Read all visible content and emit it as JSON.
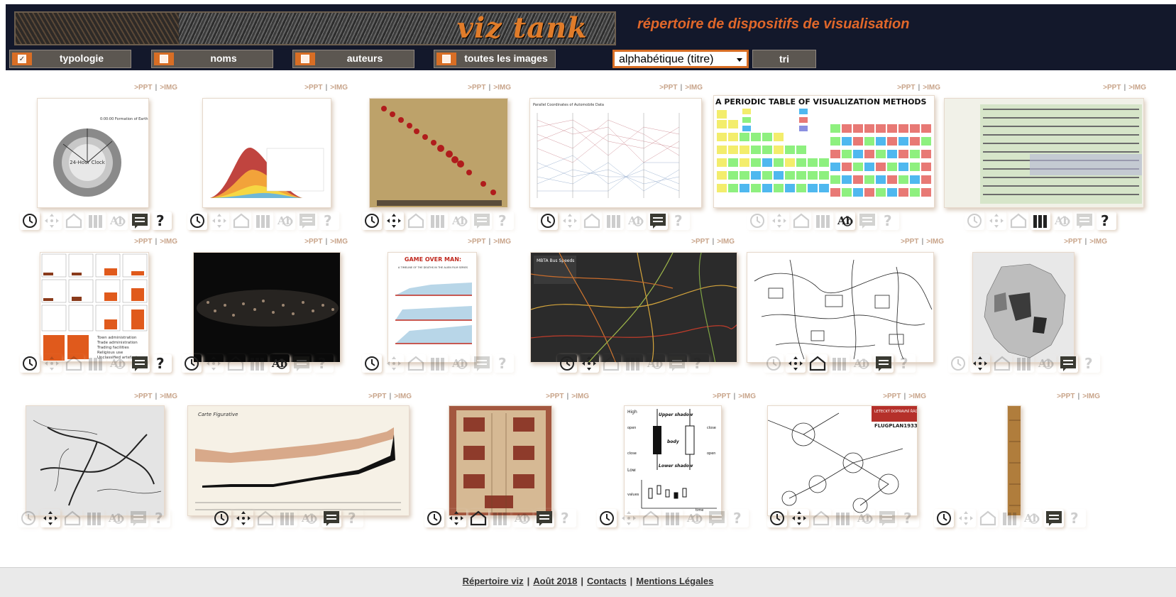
{
  "header": {
    "logo_text": "viz tank",
    "subtitle": "répertoire de dispositifs de visualisation"
  },
  "filters": [
    {
      "label": "typologie",
      "checked": true
    },
    {
      "label": "noms",
      "checked": false
    },
    {
      "label": "auteurs",
      "checked": false
    },
    {
      "label": "toutes les images",
      "checked": false
    }
  ],
  "sort": {
    "selected": "alphabétique (titre)",
    "button_label": "tri"
  },
  "card_links": {
    "ppt": ">PPT",
    "img": ">IMG"
  },
  "thumbs": {
    "clock_center": "24-Hour Clock",
    "clock_top": "0:00:00 Formation of Earth",
    "parallel_title": "Parallel Coordinates of Automobile Data",
    "periodic_title": "A PERIODIC TABLE OF VISUALIZATION METHODS",
    "alien_title": "GAME OVER MAN:",
    "alien_sub": "A TIMELINE OF THE DEATHS IN THE ALIEN FILM SERIES",
    "mbta_title": "MBTA Bus Speeds",
    "minard_title": "Carte Figurative",
    "candle_high": "High",
    "candle_upper": "Upper shadow",
    "candle_body": "body",
    "candle_lower": "Lower shadow",
    "candle_low": "Low",
    "candle_open": "open",
    "candle_close": "close",
    "candle_values": "values",
    "candle_time": "time",
    "flug_title": "LETECKÝ DOPRAVNÍ ŘÁD",
    "flug_plan": "FLUGPLAN1933",
    "legend_small": "Town administration",
    "legend_small2": "Trade administration",
    "legend_small3": "Trading facilities",
    "legend_small4": "Religious use",
    "legend_small5": "Unclassified artefacts"
  },
  "icon_states": [
    [
      1,
      0,
      0,
      0,
      0,
      1,
      1
    ],
    [
      1,
      0,
      0,
      0,
      0,
      0,
      0
    ],
    [
      1,
      1,
      0,
      0,
      0,
      0,
      0
    ],
    [
      1,
      0,
      0,
      0,
      0,
      1,
      0
    ],
    [
      0,
      0,
      0,
      0,
      1,
      0,
      0
    ],
    [
      0,
      0,
      0,
      1,
      0,
      0,
      1
    ],
    [
      1,
      0,
      0,
      0,
      0,
      1,
      1
    ],
    [
      1,
      0,
      0,
      0,
      1,
      0,
      0
    ],
    [
      1,
      0,
      0,
      0,
      0,
      0,
      0
    ],
    [
      1,
      1,
      0,
      0,
      0,
      0,
      0
    ],
    [
      0,
      1,
      1,
      0,
      0,
      1,
      0
    ],
    [
      0,
      1,
      0,
      0,
      0,
      1,
      0
    ],
    [
      0,
      1,
      0,
      0,
      0,
      0,
      0
    ],
    [
      1,
      1,
      0,
      0,
      0,
      1,
      0
    ],
    [
      1,
      1,
      1,
      0,
      0,
      1,
      0
    ],
    [
      1,
      0,
      0,
      0,
      0,
      0,
      0
    ],
    [
      1,
      1,
      0,
      0,
      0,
      0,
      0
    ],
    [
      1,
      0,
      0,
      0,
      0,
      1,
      0
    ]
  ],
  "footer": {
    "link1": "Répertoire viz",
    "link2": "Août 2018",
    "link3": "Contacts",
    "link4": "Mentions Légales",
    "sep": "|"
  }
}
